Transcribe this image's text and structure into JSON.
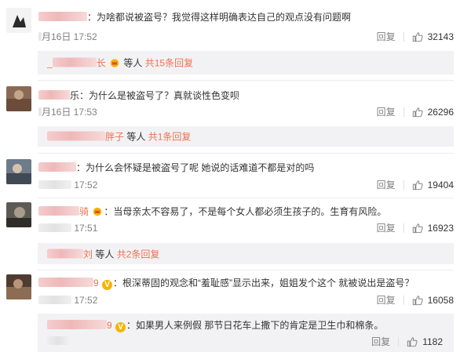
{
  "comments": [
    {
      "text": "：为啥都说被盗号？我觉得这样明确表达自己的观点没有问题啊",
      "time": "月16日 17:52",
      "reply_label": "回复",
      "likes": "32143",
      "sub": {
        "name_tail": "长",
        "middle": " 等人 ",
        "count_text": "共15条回复"
      }
    },
    {
      "text": "乐：为什么是被盗号了？真就谈性色变呗",
      "time": "月16日 17:53",
      "reply_label": "回复",
      "likes": "26296",
      "sub": {
        "name_tail": "胖子",
        "middle": " 等人 ",
        "count_text": "共1条回复"
      }
    },
    {
      "text": "：为什么会怀疑是被盗号了呢 她说的话难道不都是对的吗",
      "time": "17:52",
      "reply_label": "回复",
      "likes": "19404"
    },
    {
      "name_tail": "骑",
      "text": "：当母亲太不容易了，不是每个女人都必须生孩子的。生育有风险。",
      "time": "17:51",
      "reply_label": "回复",
      "likes": "16923",
      "sub": {
        "name_tail": "刘",
        "middle": " 等人 ",
        "count_text": "共2条回复"
      }
    },
    {
      "name_tail": "9",
      "text": "：根深蒂固的观念和“羞耻感”显示出来，姐姐发个这个 就被说出是盗号？",
      "time": "17:52",
      "reply_label": "回复",
      "likes": "16058",
      "nested": {
        "name_tail": "9",
        "text": "：如果男人来例假 那节日花车上撒下的肯定是卫生巾和棉条。",
        "reply_label": "回复",
        "likes": "1182"
      }
    }
  ],
  "colors": {
    "link": "#eb7350",
    "muted": "#808080",
    "sub_bg": "#f2f2f5"
  },
  "icons": {
    "like": "thumbs-up-icon",
    "vip": "v-badge-icon",
    "crown": "crown-badge-icon"
  }
}
